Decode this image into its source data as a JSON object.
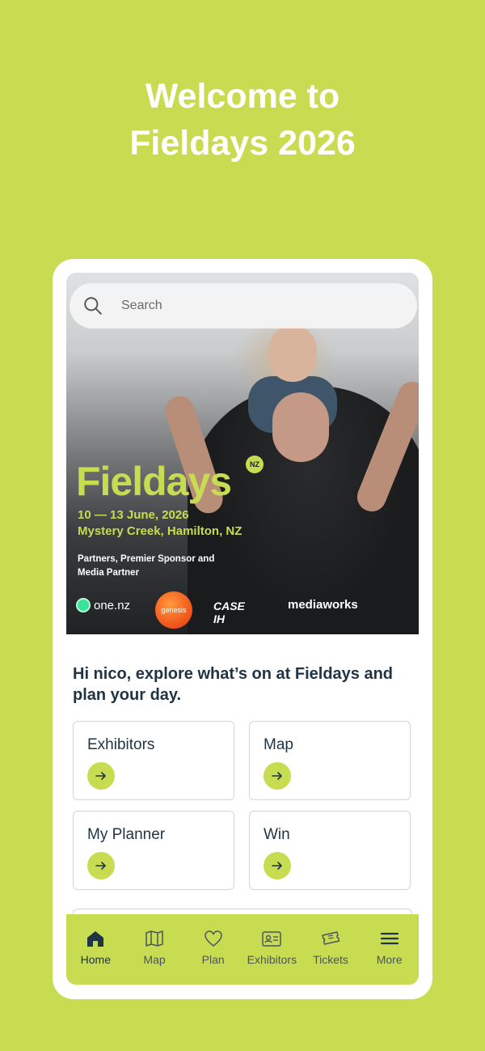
{
  "headline": {
    "line1": "Welcome to",
    "line2": "Fieldays 2026"
  },
  "search": {
    "placeholder": "Search"
  },
  "hero": {
    "brand": "Fieldays",
    "brand_badge": "NZ",
    "dates": "10 — 13 June, 2026",
    "venue": "Mystery Creek, Hamilton, NZ",
    "partners_label": "Partners, Premier Sponsor and Media Partner",
    "sponsors": [
      "one.nz",
      "genesis",
      "CASE IH",
      "mediaworks"
    ]
  },
  "greeting": "Hi nico, explore what’s on at Fieldays and plan your day.",
  "cards": [
    {
      "label": "Exhibitors"
    },
    {
      "label": "Map"
    },
    {
      "label": "My Planner"
    },
    {
      "label": "Win"
    }
  ],
  "tabs": [
    {
      "label": "Home",
      "icon": "home-icon",
      "active": true
    },
    {
      "label": "Map",
      "icon": "map-icon"
    },
    {
      "label": "Plan",
      "icon": "heart-icon"
    },
    {
      "label": "Exhibitors",
      "icon": "id-card-icon"
    },
    {
      "label": "Tickets",
      "icon": "ticket-icon"
    },
    {
      "label": "More",
      "icon": "menu-icon"
    }
  ],
  "colors": {
    "background": "#c8dc52",
    "accent": "#c8dc52",
    "text_dark": "#1f3445",
    "card_border": "#d3d6d9"
  }
}
